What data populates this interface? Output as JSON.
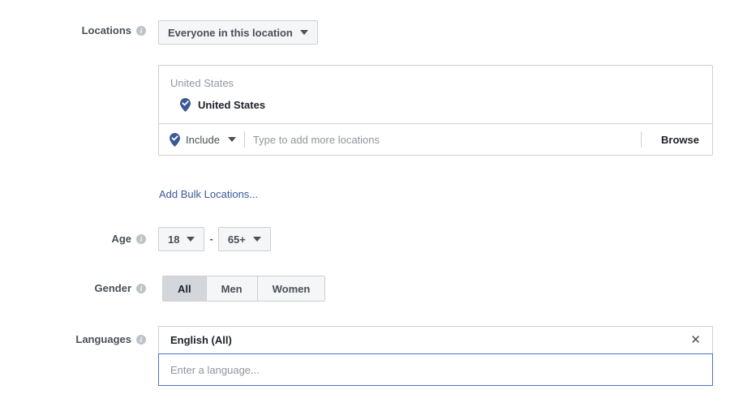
{
  "rows": {
    "locations": {
      "label": "Locations",
      "info_icon": "info-icon",
      "scope_selector": {
        "value": "Everyone in this location",
        "caret_icon": "chevron-down-icon"
      },
      "selected_section_title": "United States",
      "selected_items": [
        {
          "name": "United States",
          "pin_icon": "map-pin-check-icon"
        }
      ],
      "input_row": {
        "mode_label": "Include",
        "mode_pin_icon": "map-pin-check-icon",
        "mode_caret_icon": "chevron-down-icon",
        "placeholder": "Type to add more locations",
        "value": "",
        "browse_label": "Browse"
      },
      "bulk_link": "Add Bulk Locations..."
    },
    "age": {
      "label": "Age",
      "info_icon": "info-icon",
      "min": "18",
      "max": "65+",
      "separator": "-",
      "caret_icon": "chevron-down-icon"
    },
    "gender": {
      "label": "Gender",
      "info_icon": "info-icon",
      "options": [
        {
          "label": "All",
          "selected": true
        },
        {
          "label": "Men",
          "selected": false
        },
        {
          "label": "Women",
          "selected": false
        }
      ]
    },
    "languages": {
      "label": "Languages",
      "info_icon": "info-icon",
      "tokens": [
        {
          "label": "English (All)",
          "remove_icon": "close-icon",
          "remove_glyph": "✕"
        }
      ],
      "placeholder": "Enter a language...",
      "value": ""
    }
  },
  "colors": {
    "link": "#3b5998",
    "pin": "#3b5998",
    "border": "#ccd0d5",
    "focus_border": "#4a74c9",
    "control_bg": "#f5f6f7",
    "selected_seg_bg": "#d3d6db",
    "label_text": "#4b4f56",
    "placeholder_text": "#90949c",
    "muted_text": "#9197a3"
  }
}
